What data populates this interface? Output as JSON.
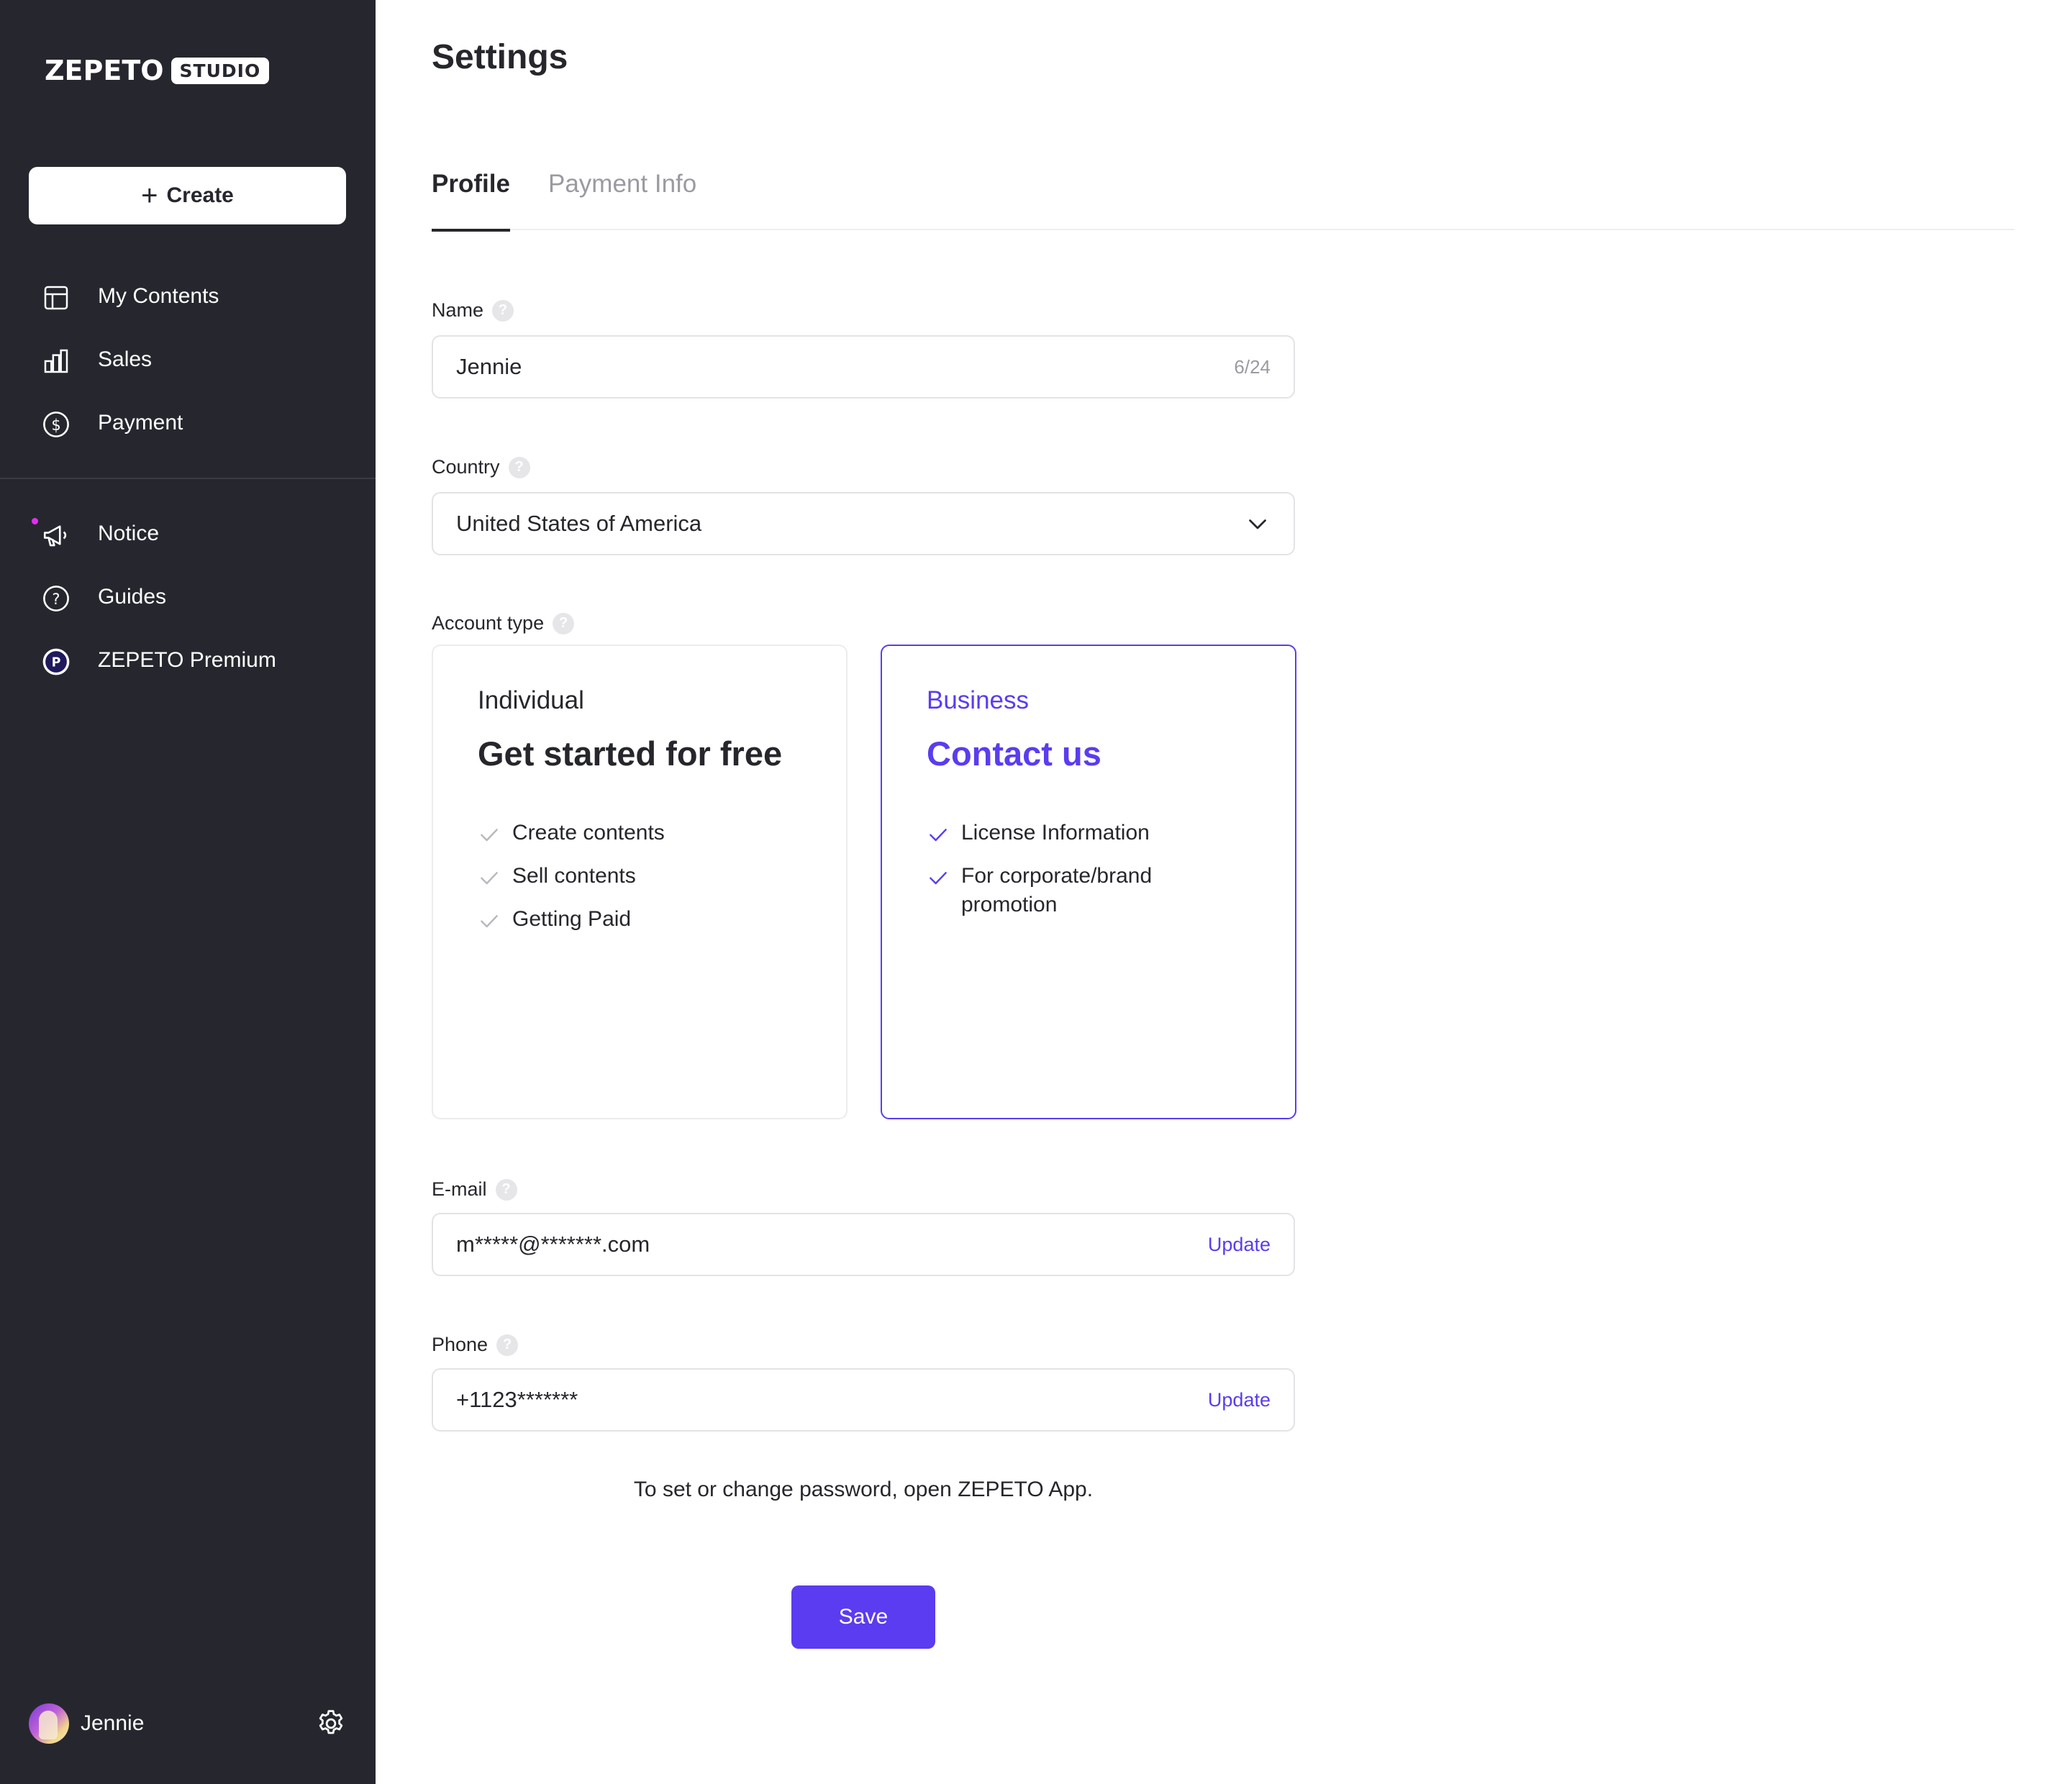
{
  "sidebar": {
    "logo_word": "ZEPETO",
    "logo_badge": "STUDIO",
    "create_label": "Create",
    "nav": [
      {
        "label": "My Contents",
        "icon": "layout-icon"
      },
      {
        "label": "Sales",
        "icon": "bar-chart-icon"
      },
      {
        "label": "Payment",
        "icon": "dollar-circle-icon"
      }
    ],
    "nav_secondary": [
      {
        "label": "Notice",
        "icon": "megaphone-icon",
        "has_dot": true
      },
      {
        "label": "Guides",
        "icon": "question-circle-icon"
      },
      {
        "label": "ZEPETO Premium",
        "icon": "premium-p-icon"
      }
    ],
    "user": {
      "name": "Jennie"
    },
    "colors": {
      "background": "#26272e",
      "notice_dot": "#e22ff0"
    }
  },
  "main": {
    "title": "Settings",
    "tabs": [
      {
        "label": "Profile",
        "active": true
      },
      {
        "label": "Payment Info",
        "active": false
      }
    ],
    "name": {
      "label": "Name",
      "value": "Jennie",
      "counter": "6/24"
    },
    "country": {
      "label": "Country",
      "value": "United States of America"
    },
    "account_type": {
      "label": "Account type",
      "individual": {
        "kind": "Individual",
        "headline": "Get started for free",
        "features": [
          "Create contents",
          "Sell contents",
          "Getting Paid"
        ]
      },
      "business": {
        "kind": "Business",
        "headline": "Contact us",
        "features": [
          "License Information",
          "For corporate/brand promotion"
        ],
        "selected": true
      }
    },
    "email": {
      "label": "E-mail",
      "value": "m*****@*******.com",
      "action": "Update"
    },
    "phone": {
      "label": "Phone",
      "value": "+1123*******",
      "action": "Update"
    },
    "password_note": "To set or change password, open ZEPETO App.",
    "save_label": "Save",
    "colors": {
      "accent": "#5b3cf0",
      "text": "#26272c",
      "muted": "#9a9ba1"
    }
  }
}
